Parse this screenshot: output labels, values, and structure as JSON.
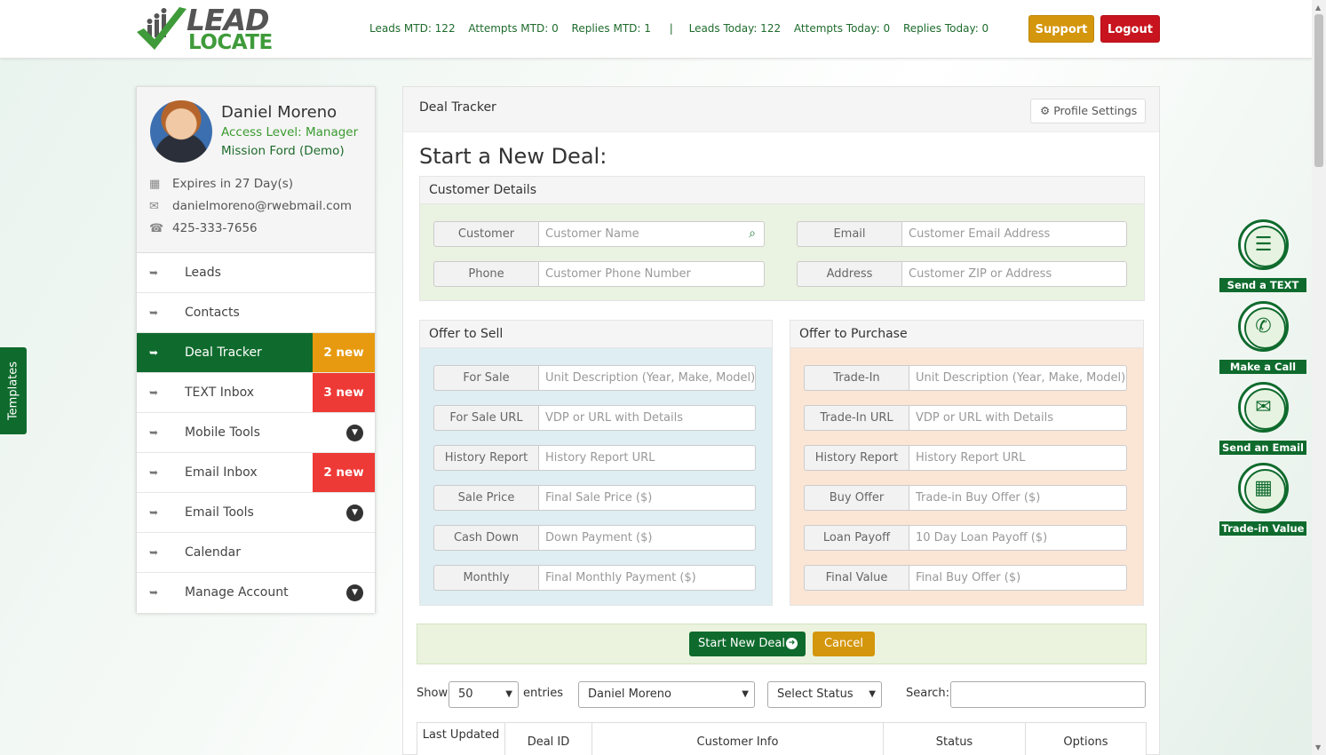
{
  "brand": {
    "logo_line1": "LEAD",
    "logo_line2": "LOCATE"
  },
  "stats": {
    "leads_mtd": "Leads MTD: 122",
    "attempts_mtd": "Attempts MTD: 0",
    "replies_mtd": "Replies MTD: 1",
    "separator": "|",
    "leads_today": "Leads Today: 122",
    "attempts_today": "Attempts Today: 0",
    "replies_today": "Replies Today: 0"
  },
  "header_buttons": {
    "support": "Support",
    "logout": "Logout"
  },
  "profile": {
    "name": "Daniel Moreno",
    "access": "Access Level: Manager",
    "dealer": "Mission Ford (Demo)",
    "expires": "Expires in 27 Day(s)",
    "email": "danielmoreno@rwebmail.com",
    "phone": "425-333-7656"
  },
  "menu": [
    {
      "label": "Leads",
      "badge": "",
      "dropdown": false
    },
    {
      "label": "Contacts",
      "badge": "",
      "dropdown": false
    },
    {
      "label": "Deal Tracker",
      "badge": "2 new",
      "dropdown": false,
      "active": true
    },
    {
      "label": "TEXT Inbox",
      "badge": "3 new",
      "dropdown": false
    },
    {
      "label": "Mobile Tools",
      "badge": "",
      "dropdown": true
    },
    {
      "label": "Email Inbox",
      "badge": "2 new",
      "dropdown": false
    },
    {
      "label": "Email Tools",
      "badge": "",
      "dropdown": true
    },
    {
      "label": "Calendar",
      "badge": "",
      "dropdown": false
    },
    {
      "label": "Manage Account",
      "badge": "",
      "dropdown": true
    }
  ],
  "templates_tab": "Templates",
  "main": {
    "title": "Deal Tracker",
    "profile_settings": "Profile Settings",
    "heading": "Start a New Deal:"
  },
  "customer_details": {
    "title": "Customer Details",
    "customer": {
      "label": "Customer",
      "placeholder": "Customer Name"
    },
    "email": {
      "label": "Email",
      "placeholder": "Customer Email Address"
    },
    "phone": {
      "label": "Phone",
      "placeholder": "Customer Phone Number"
    },
    "address": {
      "label": "Address",
      "placeholder": "Customer ZIP or Address"
    }
  },
  "offer_sell": {
    "title": "Offer to Sell",
    "fields": [
      {
        "label": "For Sale",
        "placeholder": "Unit Description (Year, Make, Model)"
      },
      {
        "label": "For Sale URL",
        "placeholder": "VDP or URL with Details"
      },
      {
        "label": "History Report",
        "placeholder": "History Report URL"
      },
      {
        "label": "Sale Price",
        "placeholder": "Final Sale Price ($)"
      },
      {
        "label": "Cash Down",
        "placeholder": "Down Payment ($)"
      },
      {
        "label": "Monthly",
        "placeholder": "Final Monthly Payment ($)"
      }
    ]
  },
  "offer_purchase": {
    "title": "Offer to Purchase",
    "fields": [
      {
        "label": "Trade-In",
        "placeholder": "Unit Description (Year, Make, Model)"
      },
      {
        "label": "Trade-In URL",
        "placeholder": "VDP or URL with Details"
      },
      {
        "label": "History Report",
        "placeholder": "History Report URL"
      },
      {
        "label": "Buy Offer",
        "placeholder": "Trade-in Buy Offer ($)"
      },
      {
        "label": "Loan Payoff",
        "placeholder": "10 Day Loan Payoff ($)"
      },
      {
        "label": "Final Value",
        "placeholder": "Final Buy Offer ($)"
      }
    ]
  },
  "actions": {
    "start": "Start New Deal",
    "cancel": "Cancel"
  },
  "table_controls": {
    "show": "Show",
    "entries_value": "50",
    "entries": "entries",
    "user_filter": "Daniel Moreno",
    "status_filter": "Select Status",
    "search": "Search:"
  },
  "table_headers": [
    "Last Updated",
    "Deal ID",
    "Customer Info",
    "Status",
    "Options"
  ],
  "quick_actions": [
    {
      "label": "Send a TEXT",
      "icon": "chat-icon"
    },
    {
      "label": "Make a Call",
      "icon": "phone-icon"
    },
    {
      "label": "Send an Email",
      "icon": "envelope-icon"
    },
    {
      "label": "Trade-in Value",
      "icon": "calculator-icon"
    }
  ],
  "colors": {
    "brand_green": "#0f6b2d",
    "support": "#d4960d",
    "logout": "#c8141e",
    "badge_orange": "#e79a0f",
    "badge_red": "#ee3a36",
    "sell_panel_bg": "#deeef2",
    "purchase_panel_bg": "#fbe5d5",
    "customer_panel_bg": "#eaf2e1"
  }
}
